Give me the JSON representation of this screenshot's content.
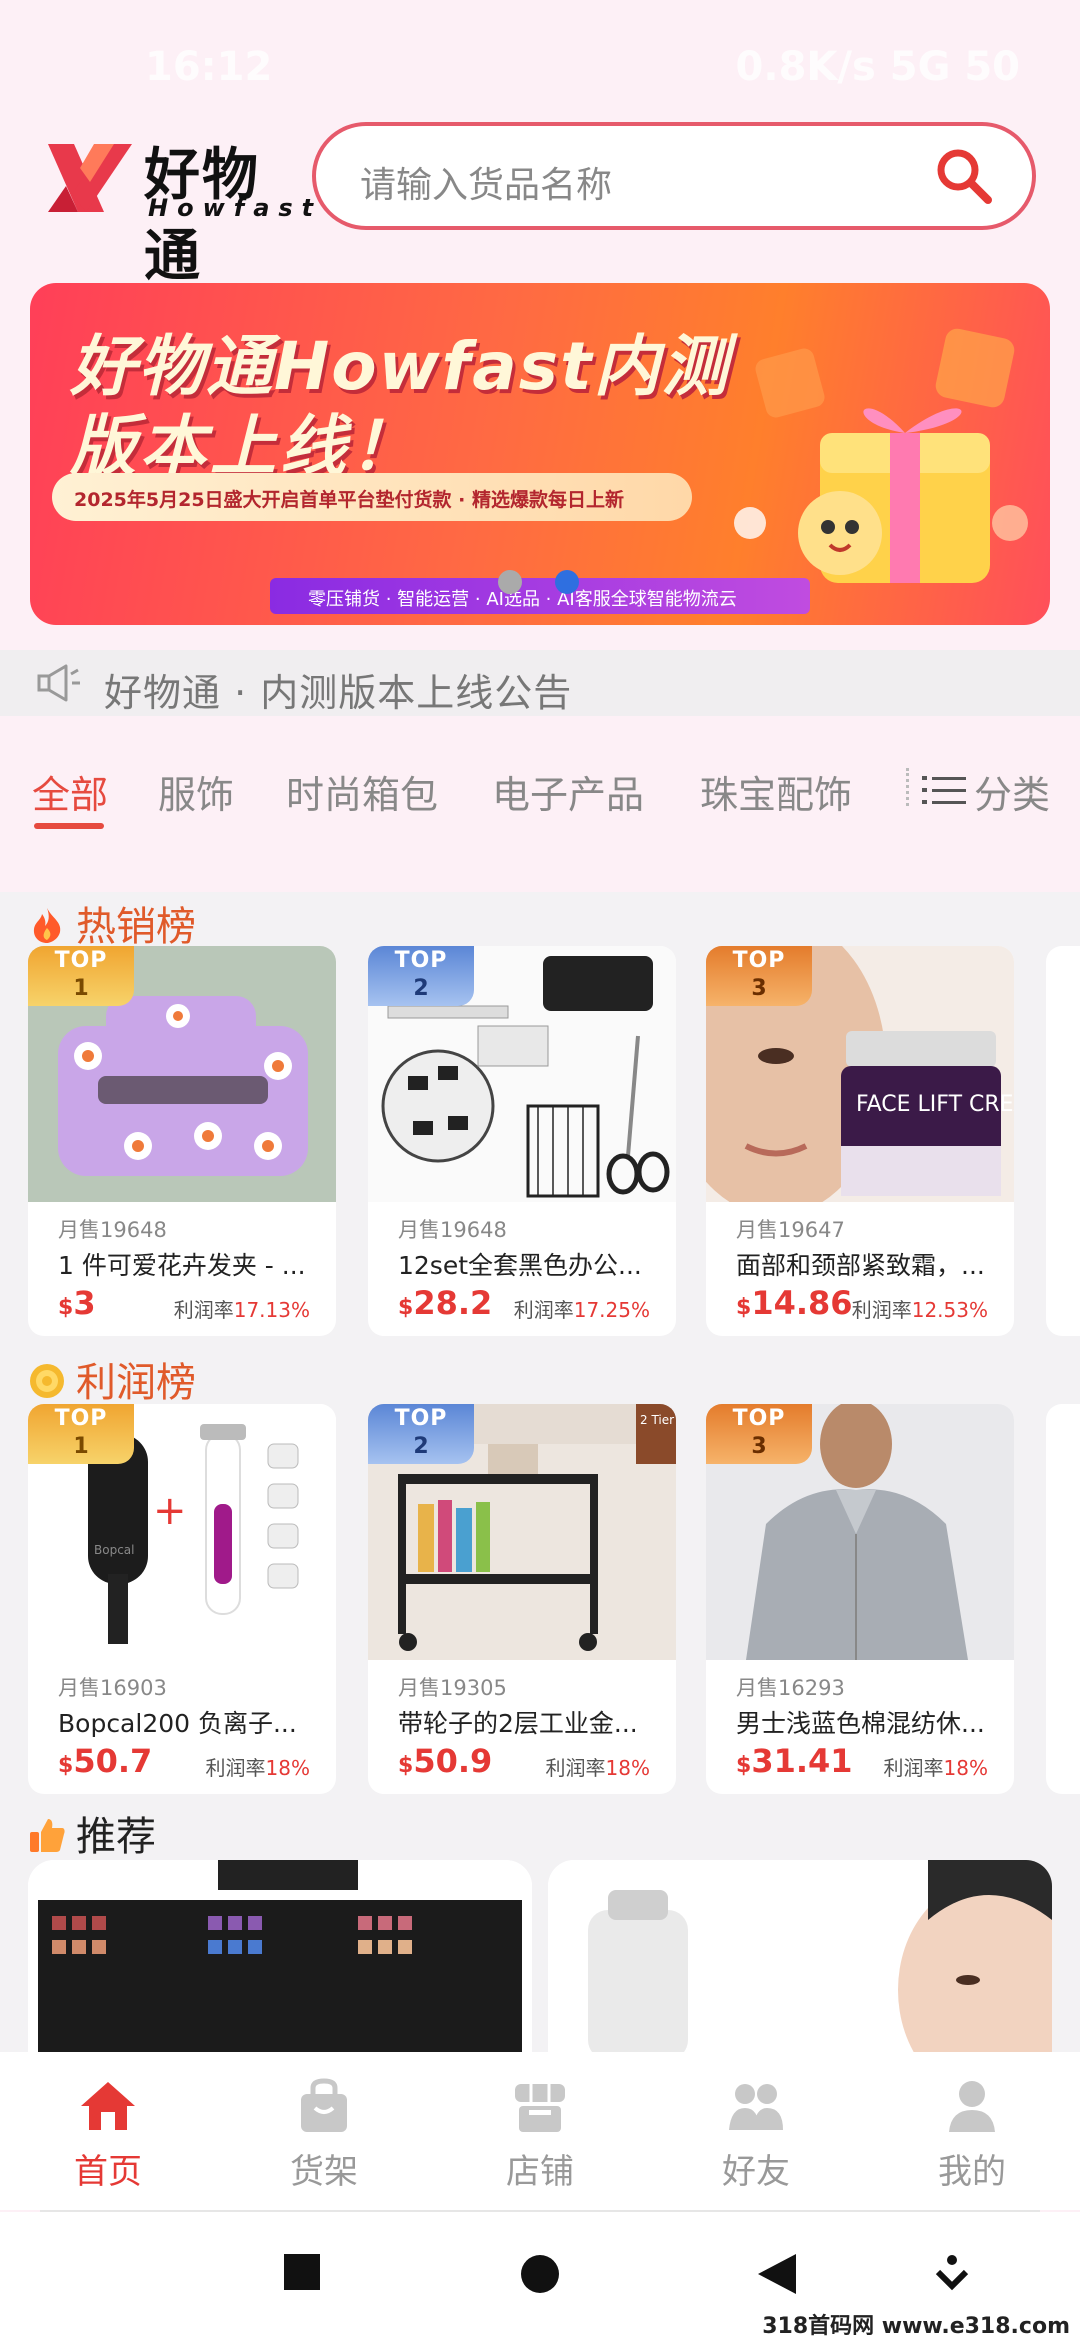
{
  "status_bar": {
    "time": "16:12",
    "right": "0.8K/s 5G 50"
  },
  "header": {
    "logo_cn": "好物通",
    "logo_en": "Howfast",
    "search_placeholder": "请输入货品名称"
  },
  "banner": {
    "title_line1": "好物通Howfast内测",
    "title_line2": "版本上线！",
    "subtitle": "2025年5月25日盛大开启首单平台垫付货款 · 精选爆款每日上新",
    "tagline": "零压铺货 · 智能运营 · AI选品 · AI客服全球智能物流云"
  },
  "notice": {
    "text": "好物通 · 内测版本上线公告"
  },
  "tabs": {
    "items": [
      "全部",
      "服饰",
      "时尚箱包",
      "电子产品",
      "珠宝配饰"
    ],
    "category_label": "分类"
  },
  "hot": {
    "title": "热销榜",
    "products": [
      {
        "rank_top": "TOP",
        "rank": "1",
        "sold": "月售19648",
        "name": "1 件可爱花卉发夹 - ...",
        "currency": "$",
        "price": "3",
        "margin_label": "利润率",
        "margin": "17.13%"
      },
      {
        "rank_top": "TOP",
        "rank": "2",
        "sold": "月售19648",
        "name": "12set全套黑色办公...",
        "currency": "$",
        "price": "28.2",
        "margin_label": "利润率",
        "margin": "17.25%"
      },
      {
        "rank_top": "TOP",
        "rank": "3",
        "sold": "月售19647",
        "name": "面部和颈部紧致霜，...",
        "currency": "$",
        "price": "14.86",
        "margin_label": "利润率",
        "margin": "12.53%"
      }
    ]
  },
  "profit": {
    "title": "利润榜",
    "products": [
      {
        "rank_top": "TOP",
        "rank": "1",
        "sold": "月售16903",
        "name": "Bopcal200 负离子...",
        "currency": "$",
        "price": "50.7",
        "margin_label": "利润率",
        "margin": "18%"
      },
      {
        "rank_top": "TOP",
        "rank": "2",
        "sold": "月售19305",
        "name": "带轮子的2层工业金...",
        "currency": "$",
        "price": "50.9",
        "margin_label": "利润率",
        "margin": "18%"
      },
      {
        "rank_top": "TOP",
        "rank": "3",
        "sold": "月售16293",
        "name": "男士浅蓝色棉混纺休...",
        "currency": "$",
        "price": "31.41",
        "margin_label": "利润率",
        "margin": "18%"
      }
    ]
  },
  "recommend": {
    "title": "推荐"
  },
  "product_images": {
    "hot_3_text": "FACE LIFT CREAM",
    "profit_1_text": "Bopcal",
    "profit_2_text": "2 Tier"
  },
  "bottom_nav": {
    "items": [
      {
        "label": "首页",
        "icon": "home-icon"
      },
      {
        "label": "货架",
        "icon": "bag-icon"
      },
      {
        "label": "店铺",
        "icon": "store-icon"
      },
      {
        "label": "好友",
        "icon": "friends-icon"
      },
      {
        "label": "我的",
        "icon": "profile-icon"
      }
    ]
  },
  "watermark": "318首码网 www.e318.com",
  "colors": {
    "accent": "#e53935",
    "tab_active": "#e64a3f",
    "search_border": "#e65a6b",
    "page_bg": "#fdf0f6",
    "content_bg": "#f3f2f4"
  }
}
